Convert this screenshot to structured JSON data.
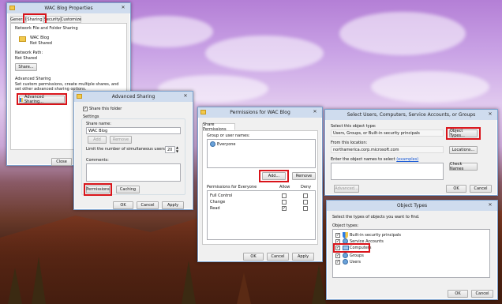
{
  "w1": {
    "title": "WAC Blog Properties",
    "tabs": [
      "General",
      "Sharing",
      "Security",
      "Customize"
    ],
    "section_network": "Network File and Folder Sharing",
    "folder_name": "WAC Blog",
    "folder_status": "Not Shared",
    "network_path_label": "Network Path:",
    "network_path_value": "Not Shared",
    "share_btn": "Share...",
    "section_advanced": "Advanced Sharing",
    "advanced_desc": "Set custom permissions, create multiple shares, and set other advanced sharing options.",
    "advanced_btn": "Advanced Sharing...",
    "close_btn": "Close"
  },
  "w2": {
    "title": "Advanced Sharing",
    "share_this_folder": "Share this folder",
    "settings": "Settings",
    "share_name_label": "Share name:",
    "share_name_value": "WAC Blog",
    "add_btn": "Add",
    "remove_btn": "Remove",
    "limit_label": "Limit the number of simultaneous users to:",
    "limit_value": "20",
    "comments_label": "Comments:",
    "permissions_btn": "Permissions",
    "caching_btn": "Caching",
    "ok": "OK",
    "cancel": "Cancel",
    "apply": "Apply"
  },
  "w3": {
    "title": "Permissions for WAC Blog",
    "tab": "Share Permissions",
    "group_label": "Group or user names:",
    "everyone": "Everyone",
    "add_btn": "Add...",
    "remove_btn": "Remove",
    "perm_label": "Permissions for Everyone",
    "allow": "Allow",
    "deny": "Deny",
    "rows": [
      {
        "name": "Full Control",
        "allow": false,
        "deny": false
      },
      {
        "name": "Change",
        "allow": false,
        "deny": false
      },
      {
        "name": "Read",
        "allow": true,
        "deny": false
      }
    ],
    "ok": "OK",
    "cancel": "Cancel",
    "apply": "Apply"
  },
  "w4": {
    "title": "Select Users, Computers, Service Accounts, or Groups",
    "object_type_label": "Select this object type:",
    "object_type_value": "Users, Groups, or Built-in security principals",
    "object_types_btn": "Object Types...",
    "location_label": "From this location:",
    "location_value": "northamerica.corp.microsoft.com",
    "locations_btn": "Locations...",
    "names_label": "Enter the object names to select",
    "examples": "(examples)",
    "check_names_btn": "Check Names",
    "advanced_btn": "Advanced...",
    "ok": "OK",
    "cancel": "Cancel"
  },
  "w5": {
    "title": "Object Types",
    "instruction": "Select the types of objects you want to find.",
    "types_label": "Object types:",
    "items": [
      {
        "label": "Built-in security principals",
        "checked": true
      },
      {
        "label": "Service Accounts",
        "checked": true
      },
      {
        "label": "Computers",
        "checked": true
      },
      {
        "label": "Groups",
        "checked": true
      },
      {
        "label": "Users",
        "checked": true
      }
    ],
    "ok": "OK",
    "cancel": "Cancel"
  },
  "highlight_color": "#d9141a"
}
